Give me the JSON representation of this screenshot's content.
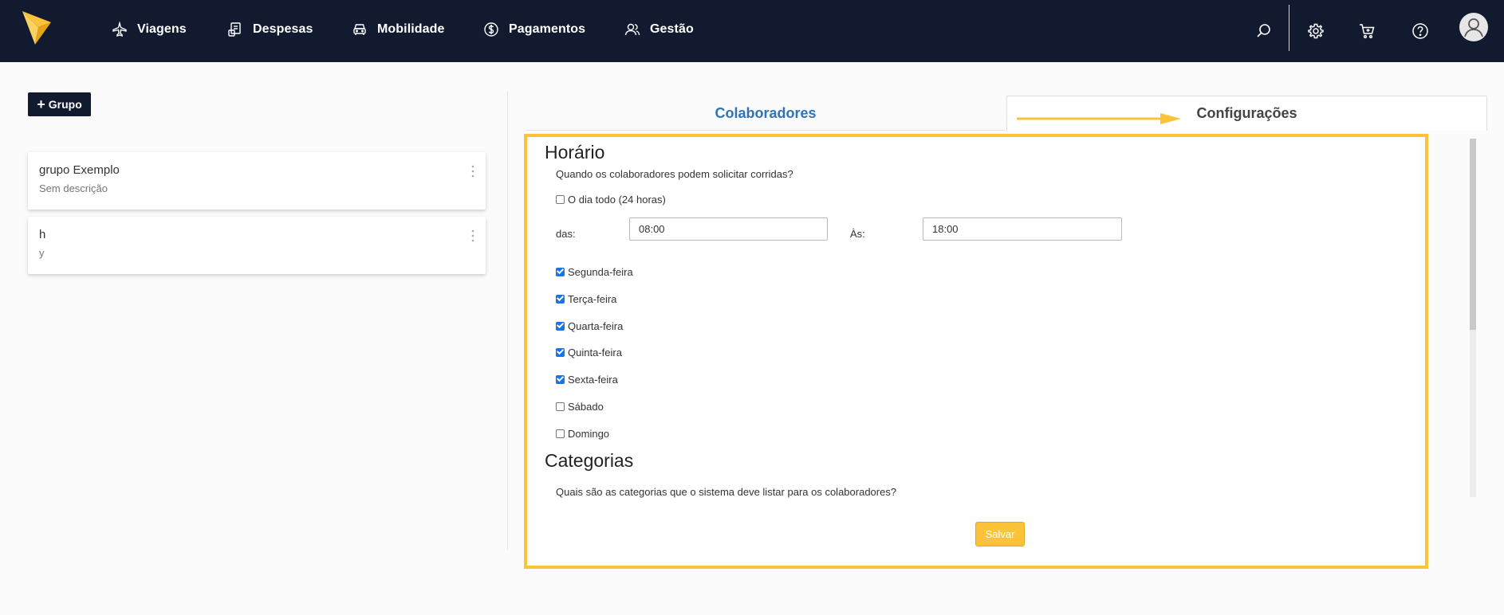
{
  "nav": {
    "items": [
      {
        "label": "Viagens",
        "icon": "airplane-icon"
      },
      {
        "label": "Despesas",
        "icon": "receipt-icon"
      },
      {
        "label": "Mobilidade",
        "icon": "car-icon"
      },
      {
        "label": "Pagamentos",
        "icon": "dollar-icon"
      },
      {
        "label": "Gestão",
        "icon": "users-icon"
      }
    ],
    "right_icons": [
      "search-icon",
      "gear-icon",
      "cart-icon",
      "help-icon",
      "avatar"
    ]
  },
  "sidebar": {
    "add_button_label": "Grupo",
    "groups": [
      {
        "title": "grupo Exemplo",
        "description": "Sem descrição"
      },
      {
        "title": "h",
        "description": "y"
      }
    ]
  },
  "tabs": {
    "colaboradores": "Colaboradores",
    "configuracoes": "Configurações",
    "active": "Configurações"
  },
  "horario": {
    "title": "Horário",
    "question": "Quando os colaboradores podem solicitar corridas?",
    "all_day_label": "O dia todo (24 horas)",
    "all_day_checked": false,
    "from_label": "das:",
    "from_value": "08:00",
    "to_label": "Às:",
    "to_value": "18:00",
    "days": [
      {
        "label": "Segunda-feira",
        "checked": true
      },
      {
        "label": "Terça-feira",
        "checked": true
      },
      {
        "label": "Quarta-feira",
        "checked": true
      },
      {
        "label": "Quinta-feira",
        "checked": true
      },
      {
        "label": "Sexta-feira",
        "checked": true
      },
      {
        "label": "Sábado",
        "checked": false
      },
      {
        "label": "Domingo",
        "checked": false
      }
    ]
  },
  "categorias": {
    "title": "Categorias",
    "question": "Quais são as categorias que o sistema deve listar para os colaboradores?"
  },
  "save_label": "Salvar",
  "colors": {
    "navbar": "#121a30",
    "accent": "#fbc33a",
    "tab_link": "#2f73b8",
    "checkbox": "#1a73e8"
  }
}
